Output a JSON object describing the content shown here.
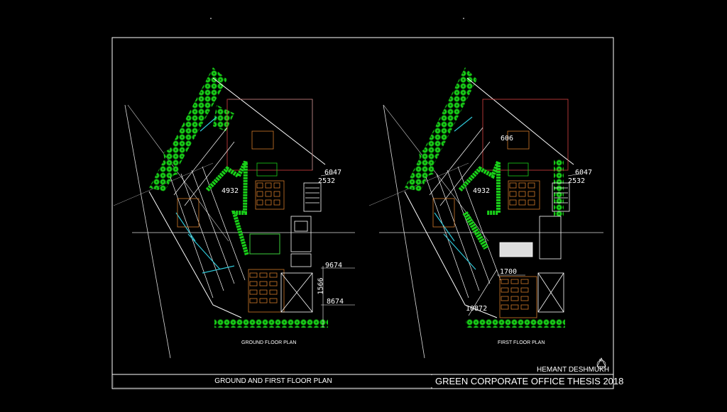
{
  "drawing": {
    "ground_floor_label": "GROUND FLOOR PLAN",
    "first_floor_label": "FIRST FLOOR PLAN",
    "dimensions": {
      "gf_a": "6047",
      "gf_b": "2532",
      "gf_c": "4932",
      "gf_d": "9674",
      "gf_e": "1566",
      "gf_f": "8674",
      "ff_a": "6047",
      "ff_b": "2532",
      "ff_c": "4932",
      "ff_d": "1700",
      "ff_e": "10872",
      "ff_f": "606"
    }
  },
  "title_block": {
    "sheet_title": "GROUND AND FIRST FLOOR PLAN",
    "project_title": "GREEN CORPORATE OFFICE THESIS 2018",
    "author": "HEMANT DESHMUKH",
    "north_mark": "N"
  },
  "colors": {
    "background": "#000000",
    "linework": "#ffffff",
    "vegetation": "#19d019",
    "furniture": "#d07a2a",
    "glazing": "#2fc8d8",
    "annotation_red": "#d84040"
  }
}
